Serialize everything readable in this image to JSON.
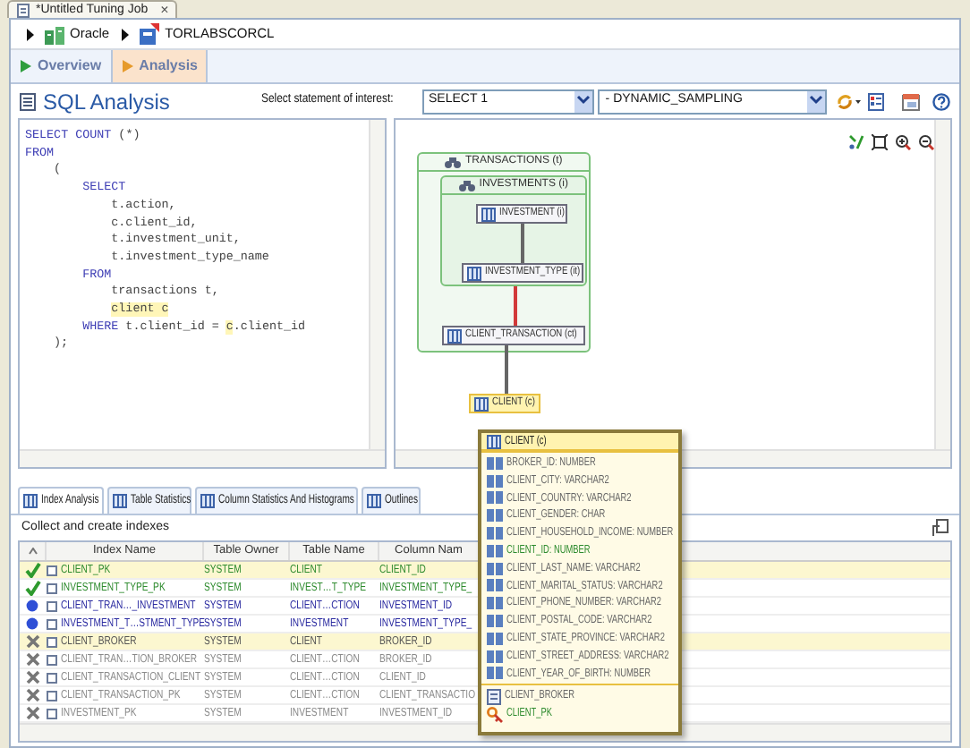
{
  "editor_tab": {
    "title": "*Untitled Tuning Job",
    "close": "×"
  },
  "breadcrumb": [
    {
      "label": "Oracle",
      "kind": "database"
    },
    {
      "label": "TORLABSCORCL",
      "kind": "connection"
    }
  ],
  "tabs": [
    {
      "label": "Overview",
      "selected": false
    },
    {
      "label": "Analysis",
      "selected": true
    }
  ],
  "header": {
    "title": "SQL Analysis",
    "statement_label": "Select statement of interest:",
    "statement": "SELECT 1",
    "hint": "- DYNAMIC_SAMPLING"
  },
  "sql": {
    "lines": [
      [
        {
          "text": "SELECT COUNT",
          "kind": "keyword"
        },
        {
          "text": " (*)",
          "kind": "text"
        }
      ],
      [
        {
          "text": "FROM",
          "kind": "keyword"
        }
      ],
      [
        {
          "text": "(",
          "kind": "text"
        }
      ],
      [
        {
          "text": "SELECT",
          "kind": "keyword"
        }
      ],
      [
        {
          "text": "t.action,",
          "kind": "text"
        }
      ],
      [
        {
          "text": "c.client_id,",
          "kind": "text"
        }
      ],
      [
        {
          "text": "t.investment_unit,",
          "kind": "text"
        }
      ],
      [
        {
          "text": "t.investment_type_name",
          "kind": "text"
        }
      ],
      [
        {
          "text": "FROM",
          "kind": "keyword"
        }
      ],
      [
        {
          "text": "transactions t,",
          "kind": "text"
        }
      ],
      [
        {
          "text": "client c",
          "kind": "match"
        }
      ],
      [
        {
          "text": "WHERE",
          "kind": "keyword"
        },
        {
          "text": " t.client_id = ",
          "kind": "text"
        },
        {
          "text": "c",
          "kind": "match"
        },
        {
          "text": ".client_id",
          "kind": "text"
        }
      ],
      [
        {
          "text": ");",
          "kind": "text"
        }
      ]
    ]
  },
  "diagram": {
    "groups": [
      {
        "label": "TRANSACTIONS (t)"
      },
      {
        "label": "INVESTMENTS (i)"
      }
    ],
    "tables": [
      {
        "label": "INVESTMENT (i)",
        "selected": false
      },
      {
        "label": "INVESTMENT_TYPE (it)",
        "selected": false
      },
      {
        "label": "CLIENT_TRANSACTION (ct)",
        "selected": false
      },
      {
        "label": "CLIENT (c)",
        "selected": true
      }
    ],
    "joins": [
      {
        "warning": false
      },
      {
        "warning": true
      },
      {
        "warning": false
      }
    ]
  },
  "details_tabs": [
    {
      "label": "Index Analysis",
      "selected": true
    },
    {
      "label": "Table Statistics",
      "selected": false
    },
    {
      "label": "Column Statistics And Histograms",
      "selected": false
    },
    {
      "label": "Outlines",
      "selected": false
    }
  ],
  "index_panel": {
    "caption": "Collect and create indexes",
    "columns": [
      "Index Name",
      "Table Owner",
      "Table Name",
      "Column Nam"
    ],
    "rows": [
      {
        "kind": "accepted",
        "checked": false,
        "highlighted": true,
        "cells": [
          "CLIENT_PK",
          "SYSTEM",
          "CLIENT",
          "CLIENT_ID"
        ]
      },
      {
        "kind": "accepted",
        "checked": false,
        "highlighted": false,
        "cells": [
          "INVESTMENT_TYPE_PK",
          "SYSTEM",
          "INVEST…T_TYPE",
          "INVESTMENT_TYPE_"
        ]
      },
      {
        "kind": "proposed",
        "checked": false,
        "highlighted": false,
        "cells": [
          "CLIENT_TRAN…_INVESTMENT",
          "SYSTEM",
          "CLIENT…CTION",
          "INVESTMENT_ID"
        ]
      },
      {
        "kind": "proposed",
        "checked": false,
        "highlighted": false,
        "cells": [
          "INVESTMENT_T…STMENT_TYPE",
          "SYSTEM",
          "INVESTMENT",
          "INVESTMENT_TYPE_"
        ]
      },
      {
        "kind": "rejected",
        "checked": false,
        "highlighted": true,
        "cells": [
          "CLIENT_BROKER",
          "SYSTEM",
          "CLIENT",
          "BROKER_ID"
        ]
      },
      {
        "kind": "rejected",
        "checked": false,
        "highlighted": false,
        "cells": [
          "CLIENT_TRAN…TION_BROKER",
          "SYSTEM",
          "CLIENT…CTION",
          "BROKER_ID"
        ]
      },
      {
        "kind": "rejected",
        "checked": false,
        "highlighted": false,
        "cells": [
          "CLIENT_TRANSACTION_CLIENT",
          "SYSTEM",
          "CLIENT…CTION",
          "CLIENT_ID"
        ]
      },
      {
        "kind": "rejected",
        "checked": false,
        "highlighted": false,
        "cells": [
          "CLIENT_TRANSACTION_PK",
          "SYSTEM",
          "CLIENT…CTION",
          "CLIENT_TRANSACTIO"
        ]
      },
      {
        "kind": "rejected",
        "checked": false,
        "highlighted": false,
        "cells": [
          "INVESTMENT_PK",
          "SYSTEM",
          "INVESTMENT",
          "INVESTMENT_ID"
        ]
      }
    ]
  },
  "table_popup": {
    "title": "CLIENT (c)",
    "columns": [
      {
        "text": "BROKER_ID: NUMBER",
        "key": false
      },
      {
        "text": "CLIENT_CITY: VARCHAR2",
        "key": false
      },
      {
        "text": "CLIENT_COUNTRY: VARCHAR2",
        "key": false
      },
      {
        "text": "CLIENT_GENDER: CHAR",
        "key": false
      },
      {
        "text": "CLIENT_HOUSEHOLD_INCOME: NUMBER",
        "key": false
      },
      {
        "text": "CLIENT_ID: NUMBER",
        "key": true
      },
      {
        "text": "CLIENT_LAST_NAME: VARCHAR2",
        "key": false
      },
      {
        "text": "CLIENT_MARITAL_STATUS: VARCHAR2",
        "key": false
      },
      {
        "text": "CLIENT_PHONE_NUMBER: VARCHAR2",
        "key": false
      },
      {
        "text": "CLIENT_POSTAL_CODE: VARCHAR2",
        "key": false
      },
      {
        "text": "CLIENT_STATE_PROVINCE: VARCHAR2",
        "key": false
      },
      {
        "text": "CLIENT_STREET_ADDRESS: VARCHAR2",
        "key": false
      },
      {
        "text": "CLIENT_YEAR_OF_BIRTH: NUMBER",
        "key": false
      }
    ],
    "indexes": [
      {
        "text": "CLIENT_BROKER",
        "kind": "index"
      },
      {
        "text": "CLIENT_PK",
        "kind": "primary_key"
      }
    ]
  }
}
